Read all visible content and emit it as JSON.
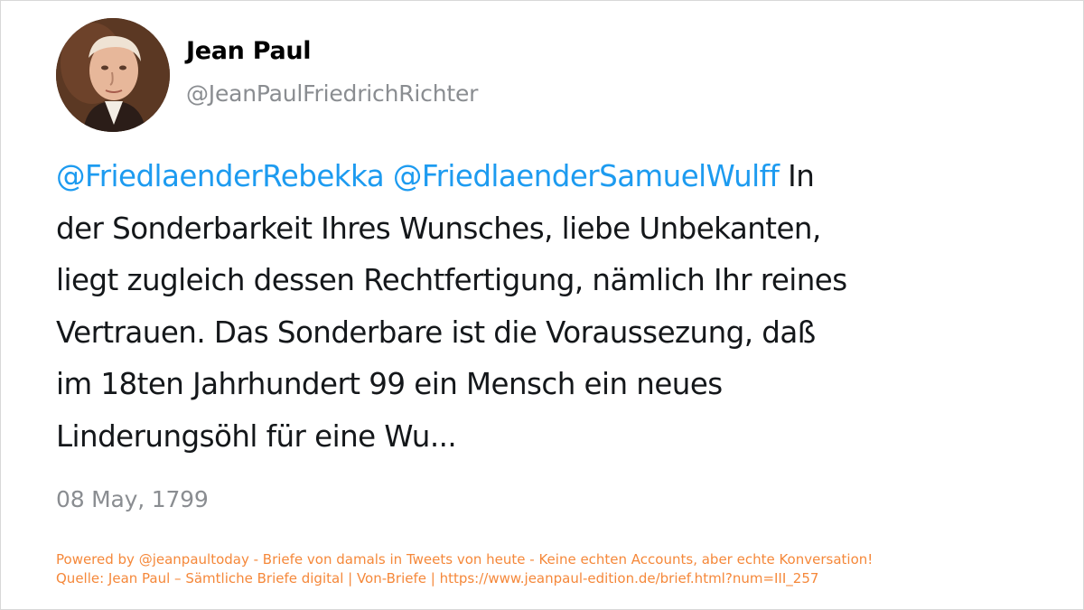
{
  "author": {
    "name": "Jean Paul",
    "handle": "@JeanPaulFriedrichRichter",
    "avatar": "portrait-avatar"
  },
  "tweet": {
    "mentions": [
      "@FriedlaenderRebekka",
      "@FriedlaenderSamuelWulff"
    ],
    "lines": [
      " In",
      "der Sonderbarkeit Ihres Wunsches, liebe Unbekanten,",
      "liegt zugleich dessen Rechtfertigung, nämlich Ihr reines",
      "Vertrauen. Das Sonderbare ist die Voraussezung, daß",
      "im 18ten Jahrhundert 99 ein Mensch ein neues",
      "Linderungsöhl für eine Wu..."
    ],
    "date": "08 May, 1799"
  },
  "footer": {
    "line1": "Powered by @jeanpaultoday - Briefe von damals in Tweets von heute - Keine echten Accounts, aber echte Konversation!",
    "line2": "Quelle: Jean Paul – Sämtliche Briefe digital | Von-Briefe | https://www.jeanpaul-edition.de/brief.html?num=III_257"
  },
  "colors": {
    "mention": "#1d9bf0",
    "text": "#14171a",
    "muted": "#8a8d91",
    "footer": "#f5883a"
  }
}
